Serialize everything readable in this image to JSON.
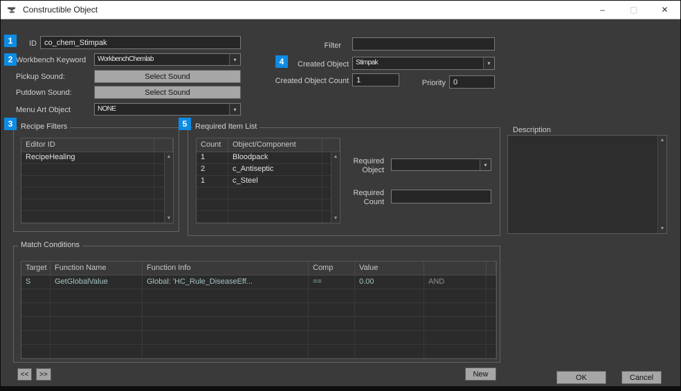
{
  "window": {
    "title": "Constructible Object",
    "minimize_glyph": "–",
    "maximize_glyph": "▢",
    "close_glyph": "✕"
  },
  "badges": {
    "b1": "1",
    "b2": "2",
    "b3": "3",
    "b4": "4",
    "b5": "5"
  },
  "form": {
    "id": {
      "label": "ID",
      "value": "co_chem_Stimpak"
    },
    "workbench_keyword": {
      "label": "Workbench Keyword",
      "value": "WorkbenchChemlab"
    },
    "pickup_sound": {
      "label": "Pickup Sound:",
      "button": "Select Sound"
    },
    "putdown_sound": {
      "label": "Putdown Sound:",
      "button": "Select Sound"
    },
    "menu_art": {
      "label": "Menu Art Object",
      "value": "NONE"
    },
    "filter": {
      "label": "Filter",
      "value": ""
    },
    "created_object": {
      "label": "Created Object",
      "value": "Stimpak"
    },
    "created_object_count": {
      "label": "Created Object Count",
      "value": "1"
    },
    "priority": {
      "label": "Priority",
      "value": "0"
    }
  },
  "recipe_filters": {
    "title": "Recipe Filters",
    "columns": {
      "editor_id": "Editor ID"
    },
    "rows": [
      {
        "editor_id": "RecipeHealing"
      }
    ]
  },
  "required_item_list": {
    "title": "Required Item List",
    "columns": {
      "count": "Count",
      "object": "Object/Component"
    },
    "rows": [
      {
        "count": "1",
        "object": "Bloodpack"
      },
      {
        "count": "2",
        "object": "c_Antiseptic"
      },
      {
        "count": "1",
        "object": "c_Steel"
      }
    ],
    "required_object_label": "Required Object",
    "required_object_value": "",
    "required_count_label": "Required Count",
    "required_count_value": ""
  },
  "description": {
    "label": "Description",
    "value": ""
  },
  "match_conditions": {
    "title": "Match Conditions",
    "columns": {
      "target": "Target",
      "function_name": "Function Name",
      "function_info": "Function Info",
      "comp": "Comp",
      "value": "Value"
    },
    "rows": [
      {
        "target": "S",
        "function_name": "GetGlobalValue",
        "function_info": "Global: 'HC_Rule_DiseaseEff...",
        "comp": "==",
        "value": "0.00",
        "operator": "AND"
      }
    ],
    "prev_label": "<<",
    "next_label": ">>",
    "new_label": "New"
  },
  "footer": {
    "ok_label": "OK",
    "cancel_label": "Cancel"
  },
  "colors": {
    "badge_blue": "#0d8ce4",
    "body_bg": "#3a3a3a",
    "titlebar_bg": "#ffffff"
  }
}
